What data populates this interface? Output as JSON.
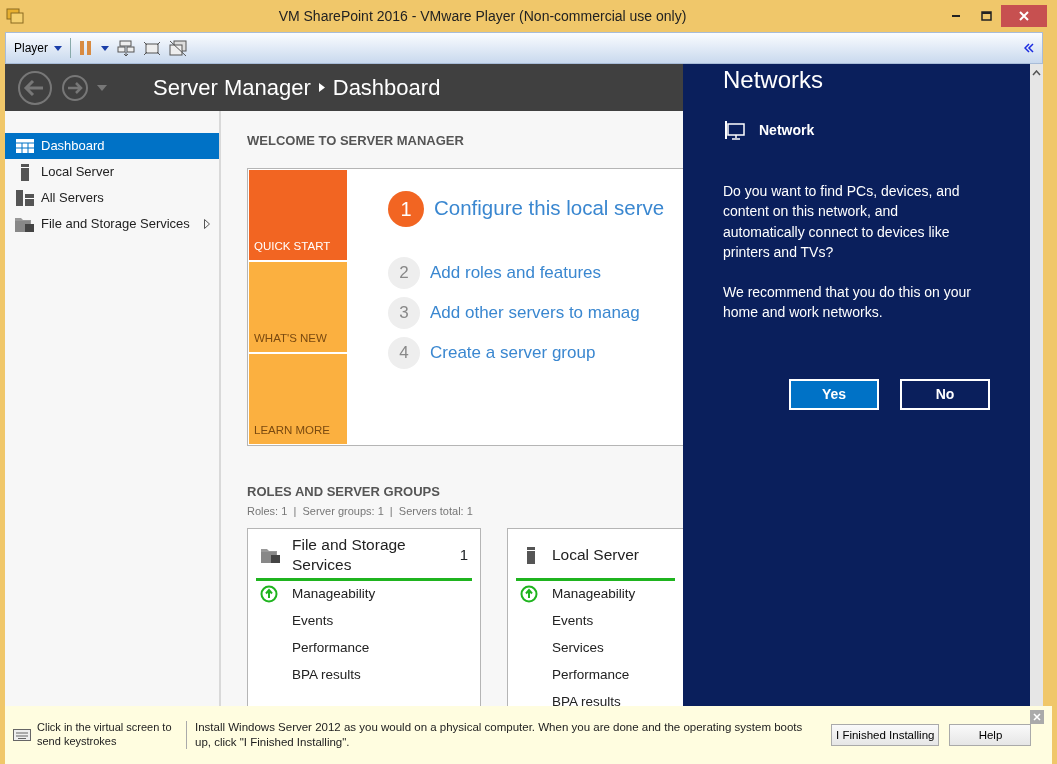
{
  "window": {
    "title": "VM SharePoint 2016 - VMware Player (Non-commercial use only)"
  },
  "toolbar": {
    "menu": "Player"
  },
  "header": {
    "app": "Server Manager",
    "page": "Dashboard"
  },
  "sidebar": {
    "items": [
      {
        "label": "Dashboard",
        "selected": true,
        "expandable": false
      },
      {
        "label": "Local Server",
        "selected": false,
        "expandable": false
      },
      {
        "label": "All Servers",
        "selected": false,
        "expandable": false
      },
      {
        "label": "File and Storage Services",
        "selected": false,
        "expandable": true
      }
    ]
  },
  "welcome": {
    "title": "WELCOME TO SERVER MANAGER",
    "tiles": [
      {
        "label": "QUICK START",
        "selected": true
      },
      {
        "label": "WHAT'S NEW",
        "selected": false
      },
      {
        "label": "LEARN MORE",
        "selected": false
      }
    ],
    "steps": [
      {
        "number": "1",
        "label": "Configure this local serve",
        "primary": true
      },
      {
        "number": "2",
        "label": "Add roles and features",
        "primary": false
      },
      {
        "number": "3",
        "label": "Add other servers to manag",
        "primary": false
      },
      {
        "number": "4",
        "label": "Create a server group",
        "primary": false
      }
    ]
  },
  "roles": {
    "title": "ROLES AND SERVER GROUPS",
    "summary": "Roles: 1  |  Server groups: 1  |  Servers total: 1",
    "cards": [
      {
        "title": "File and Storage Services",
        "count": "1",
        "rows": [
          {
            "label": "Manageability",
            "ok": true
          },
          {
            "label": "Events",
            "ok": false
          },
          {
            "label": "Performance",
            "ok": false
          },
          {
            "label": "BPA results",
            "ok": false
          }
        ]
      },
      {
        "title": "Local Server",
        "rows": [
          {
            "label": "Manageability",
            "ok": true
          },
          {
            "label": "Events",
            "ok": false
          },
          {
            "label": "Services",
            "ok": false
          },
          {
            "label": "Performance",
            "ok": false
          },
          {
            "label": "BPA results",
            "ok": false
          }
        ]
      }
    ]
  },
  "flyout": {
    "title": "Networks",
    "network": "Network",
    "paragraphs": [
      "Do you want to find PCs, devices, and content on this network, and automatically connect to devices like printers and TVs?",
      "We recommend that you do this on your home and work networks."
    ],
    "buttons": [
      {
        "label": "Yes",
        "primary": true
      },
      {
        "label": "No",
        "primary": false
      }
    ]
  },
  "info_bar": {
    "hint": "Click in the virtual screen to send keystrokes",
    "message": "Install Windows Server 2012 as you would on a physical computer. When you are done and the operating system boots up, click \"I Finished Installing\".",
    "buttons": [
      "I Finished Installing",
      "Help"
    ]
  }
}
